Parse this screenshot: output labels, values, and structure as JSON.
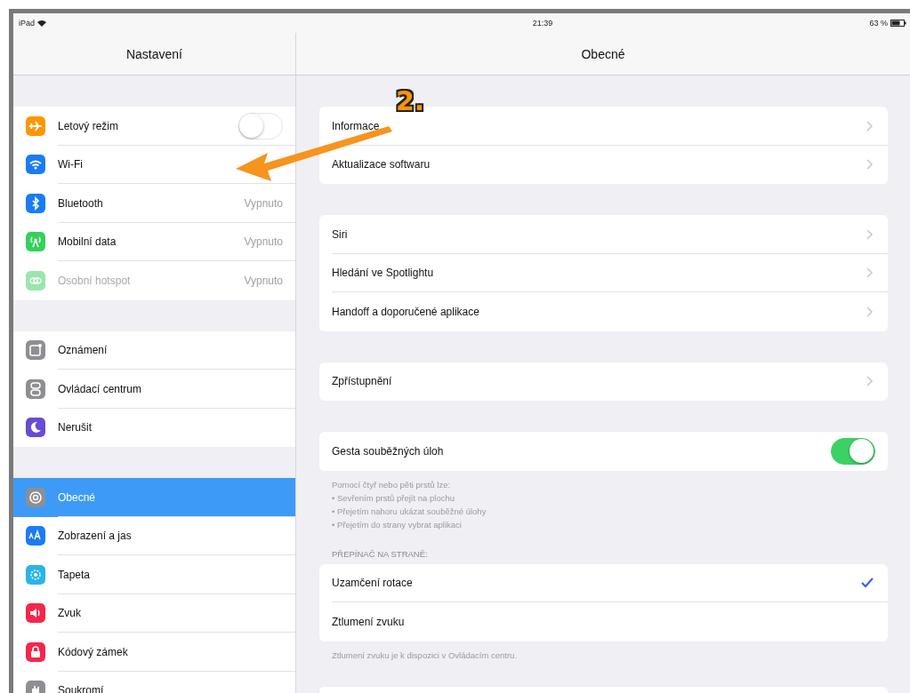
{
  "status_bar": {
    "device": "iPad",
    "time": "21:39",
    "battery": "63 %"
  },
  "sidebar": {
    "title": "Nastavení",
    "groups": [
      {
        "items": [
          {
            "label": "Letový režim",
            "kind": "switch",
            "on": false,
            "color": "#ff9500",
            "selected": false,
            "disabled": false
          },
          {
            "label": "Wi-Fi",
            "kind": "plain",
            "color": "#1a7cf5",
            "selected": false,
            "disabled": false
          },
          {
            "label": "Bluetooth",
            "kind": "detail",
            "value": "Vypnuto",
            "color": "#1a7cf5",
            "selected": false,
            "disabled": false
          },
          {
            "label": "Mobilní data",
            "kind": "detail",
            "value": "Vypnuto",
            "color": "#34d25a",
            "selected": false,
            "disabled": false
          },
          {
            "label": "Osobní hotspot",
            "kind": "detail",
            "value": "Vypnuto",
            "color": "#9ae6ad",
            "selected": false,
            "disabled": true
          }
        ]
      },
      {
        "items": [
          {
            "label": "Oznámení",
            "kind": "plain",
            "color": "#8e8e93",
            "selected": false,
            "disabled": false
          },
          {
            "label": "Ovládací centrum",
            "kind": "plain",
            "color": "#8e8e93",
            "selected": false,
            "disabled": false
          },
          {
            "label": "Nerušit",
            "kind": "plain",
            "color": "#6a4bd6",
            "selected": false,
            "disabled": false
          }
        ]
      },
      {
        "items": [
          {
            "label": "Obecné",
            "kind": "plain",
            "color": "#8e8e93",
            "selected": true,
            "disabled": false
          },
          {
            "label": "Zobrazení a jas",
            "kind": "plain",
            "color": "#1a7cf5",
            "selected": false,
            "disabled": false
          },
          {
            "label": "Tapeta",
            "kind": "plain",
            "color": "#2ab4e8",
            "selected": false,
            "disabled": false
          },
          {
            "label": "Zvuk",
            "kind": "plain",
            "color": "#f6264a",
            "selected": false,
            "disabled": false
          },
          {
            "label": "Kódový zámek",
            "kind": "plain",
            "color": "#f6264a",
            "selected": false,
            "disabled": false
          },
          {
            "label": "Soukromí",
            "kind": "plain",
            "color": "#8e8e93",
            "selected": false,
            "disabled": false
          }
        ]
      }
    ]
  },
  "detail": {
    "title": "Obecné",
    "sections": [
      {
        "rows": [
          {
            "label": "Informace",
            "kind": "chevron"
          },
          {
            "label": "Aktualizace softwaru",
            "kind": "chevron"
          }
        ]
      },
      {
        "rows": [
          {
            "label": "Siri",
            "kind": "chevron"
          },
          {
            "label": "Hledání ve Spotlightu",
            "kind": "chevron"
          },
          {
            "label": "Handoff a doporučené aplikace",
            "kind": "chevron"
          }
        ]
      },
      {
        "rows": [
          {
            "label": "Zpřístupnění",
            "kind": "chevron"
          }
        ]
      },
      {
        "rows": [
          {
            "label": "Gesta souběžných úloh",
            "kind": "switch",
            "on": true
          }
        ],
        "footer": "Pomocí čtyř nebo pěti prstů lze:\n• Sevřením prstů přejít na plochu\n• Přejetím nahoru ukázat souběžné úlohy\n• Přejetím do strany vybrat aplikaci"
      },
      {
        "header": "PŘEPÍNAČ NA STRANĚ:",
        "rows": [
          {
            "label": "Uzamčení rotace",
            "kind": "check",
            "checked": true
          },
          {
            "label": "Ztlumení zvuku",
            "kind": "check",
            "checked": false
          }
        ],
        "footer": "Ztlumení zvuku je k dispozici v Ovládacím centru."
      }
    ]
  },
  "annotation": {
    "label": "2."
  }
}
